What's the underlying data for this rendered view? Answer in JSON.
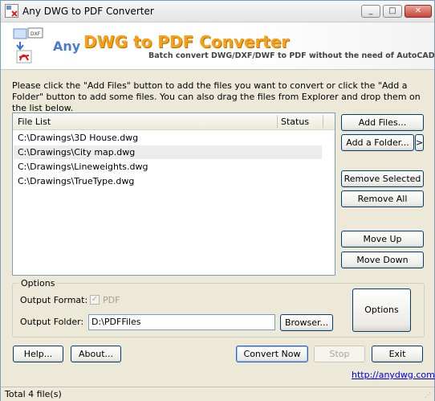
{
  "window": {
    "title": "Any DWG to PDF Converter"
  },
  "banner": {
    "any": "Any",
    "title": "DWG to PDF Converter",
    "subtitle": "Batch convert DWG/DXF/DWF to PDF without the need of AutoCAD.",
    "logo_text": "DXF"
  },
  "instructions": "Please click the \"Add Files\" button to add the files you want to convert or click the \"Add a Folder\" button to add some files. You can also drag the files from Explorer and drop them on the list below.",
  "file_list": {
    "columns": {
      "file": "File List",
      "status": "Status"
    },
    "rows": [
      "C:\\Drawings\\3D House.dwg",
      "C:\\Drawings\\City map.dwg",
      "C:\\Drawings\\Lineweights.dwg",
      "C:\\Drawings\\TrueType.dwg"
    ]
  },
  "buttons": {
    "add_files": "Add Files...",
    "add_folder": "Add a Folder...",
    "add_folder_arrow": ">",
    "remove_selected": "Remove Selected",
    "remove_all": "Remove All",
    "move_up": "Move Up",
    "move_down": "Move Down",
    "options": "Options",
    "browse": "Browser...",
    "help": "Help...",
    "about": "About...",
    "convert": "Convert Now",
    "stop": "Stop",
    "exit": "Exit"
  },
  "options": {
    "group_label": "Options",
    "format_label": "Output Format:",
    "format_value": "PDF",
    "folder_label": "Output Folder:",
    "folder_value": "D:\\PDFFiles"
  },
  "link": "http://anydwg.com",
  "status": "Total 4 file(s)",
  "icons": {
    "min": "_",
    "max": "□",
    "close": "✕",
    "check": "✓"
  }
}
